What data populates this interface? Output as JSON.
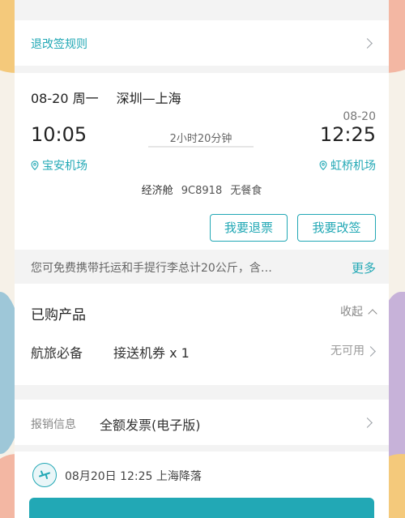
{
  "rules": {
    "label": "退改签规则"
  },
  "flight": {
    "date": "08-20 周一",
    "route": "深圳—上海",
    "arrival_date": "08-20",
    "depart_time": "10:05",
    "arrive_time": "12:25",
    "duration": "2小时20分钟",
    "depart_airport": "宝安机场",
    "arrive_airport": "虹桥机场",
    "cabin": "经济舱",
    "flight_no": "9C8918",
    "meal": "无餐食",
    "refund_label": "我要退票",
    "change_label": "我要改签"
  },
  "baggage": {
    "text": "您可免费携带托运和手提行李总计20公斤，含…",
    "more": "更多"
  },
  "products": {
    "title": "已购产品",
    "collapse": "收起",
    "category": "航旅必备",
    "item": "接送机券 x 1",
    "status": "无可用"
  },
  "invoice": {
    "label": "报销信息",
    "value": "全额发票(电子版)"
  },
  "landing": {
    "text": "08月20日  12:25 上海降落"
  },
  "colors": {
    "accent": "#22a8b5",
    "background": "#f3f3f3"
  }
}
